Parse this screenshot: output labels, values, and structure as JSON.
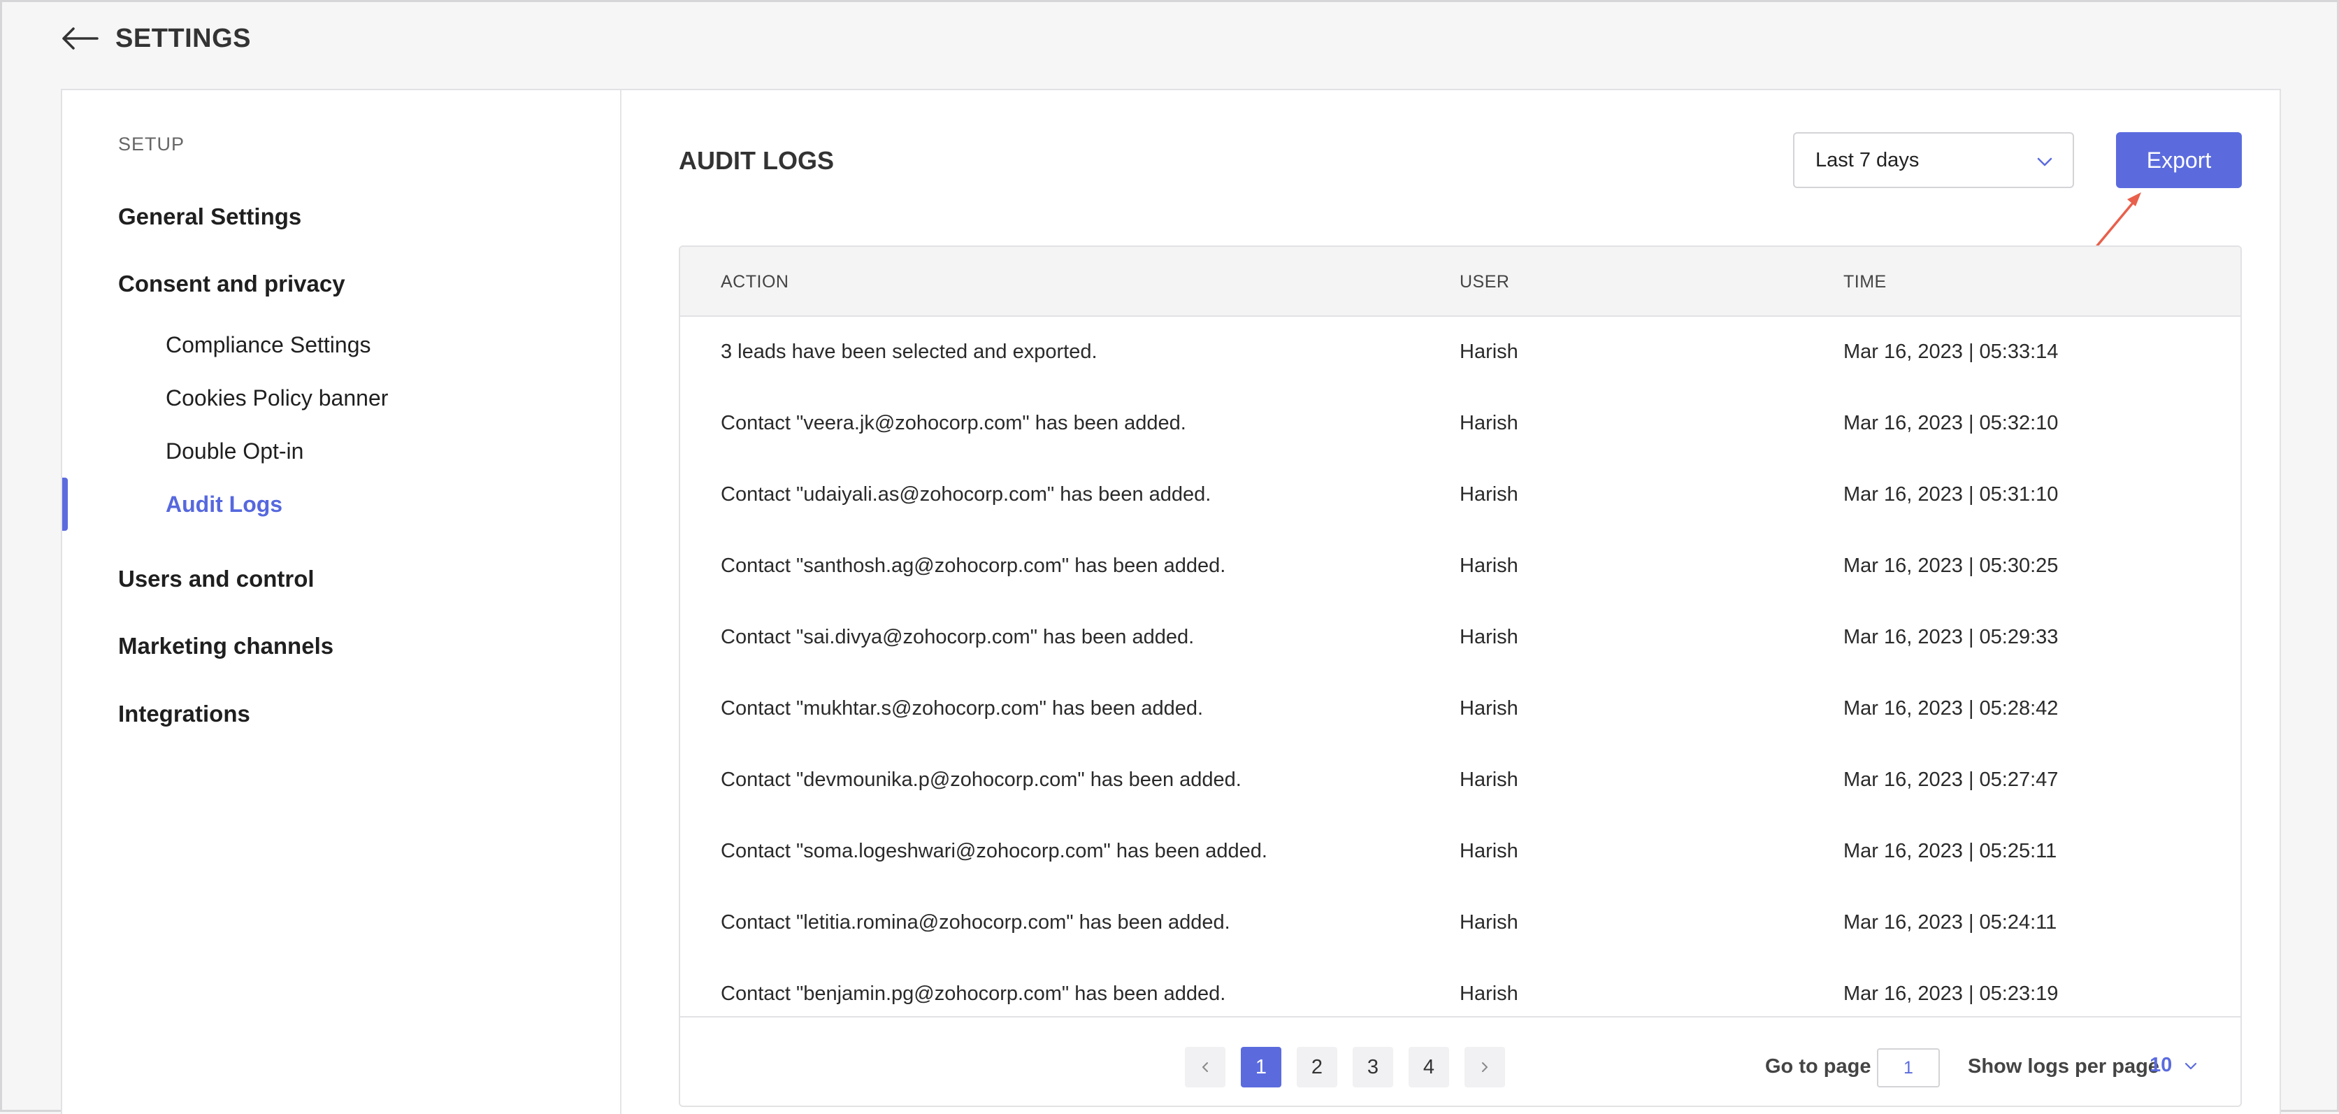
{
  "header": {
    "title": "SETTINGS"
  },
  "sidebar": {
    "setup_label": "SETUP",
    "items": [
      {
        "label": "General Settings"
      },
      {
        "label": "Consent and privacy"
      },
      {
        "label": "Users and control"
      },
      {
        "label": "Marketing channels"
      },
      {
        "label": "Integrations"
      }
    ],
    "subitems": [
      {
        "label": "Compliance Settings"
      },
      {
        "label": "Cookies Policy banner"
      },
      {
        "label": "Double Opt-in"
      },
      {
        "label": "Audit Logs",
        "active": true
      }
    ]
  },
  "main": {
    "title": "AUDIT LOGS",
    "date_filter": {
      "selected": "Last 7 days"
    },
    "export_label": "Export",
    "table": {
      "columns": [
        "ACTION",
        "USER",
        "TIME"
      ],
      "rows": [
        {
          "action": "3 leads have been selected and exported.",
          "user": "Harish",
          "time": "Mar 16, 2023 | 05:33:14"
        },
        {
          "action": "Contact \"veera.jk@zohocorp.com\" has been added.",
          "user": "Harish",
          "time": "Mar 16, 2023 | 05:32:10"
        },
        {
          "action": "Contact \"udaiyali.as@zohocorp.com\" has been added.",
          "user": "Harish",
          "time": "Mar 16, 2023 | 05:31:10"
        },
        {
          "action": "Contact \"santhosh.ag@zohocorp.com\" has been added.",
          "user": "Harish",
          "time": "Mar 16, 2023 | 05:30:25"
        },
        {
          "action": "Contact \"sai.divya@zohocorp.com\" has been added.",
          "user": "Harish",
          "time": "Mar 16, 2023 | 05:29:33"
        },
        {
          "action": "Contact \"mukhtar.s@zohocorp.com\" has been added.",
          "user": "Harish",
          "time": "Mar 16, 2023 | 05:28:42"
        },
        {
          "action": "Contact \"devmounika.p@zohocorp.com\" has been added.",
          "user": "Harish",
          "time": "Mar 16, 2023 | 05:27:47"
        },
        {
          "action": "Contact \"soma.logeshwari@zohocorp.com\" has been added.",
          "user": "Harish",
          "time": "Mar 16, 2023 | 05:25:11"
        },
        {
          "action": "Contact \"letitia.romina@zohocorp.com\" has been added.",
          "user": "Harish",
          "time": "Mar 16, 2023 | 05:24:11"
        },
        {
          "action": "Contact \"benjamin.pg@zohocorp.com\" has been added.",
          "user": "Harish",
          "time": "Mar 16, 2023 | 05:23:19"
        }
      ]
    },
    "pagination": {
      "pages": [
        "1",
        "2",
        "3",
        "4"
      ],
      "current": "1",
      "goto_label": "Go to page",
      "goto_value": "1",
      "per_page_label": "Show logs per page",
      "per_page_value": "10"
    }
  },
  "colors": {
    "accent": "#5b6bde",
    "annotation": "#e8604c"
  },
  "icons": {
    "back": "arrow-left-icon",
    "dropdown": "chevron-down-icon",
    "prev": "chevron-left-icon",
    "next": "chevron-right-icon"
  }
}
